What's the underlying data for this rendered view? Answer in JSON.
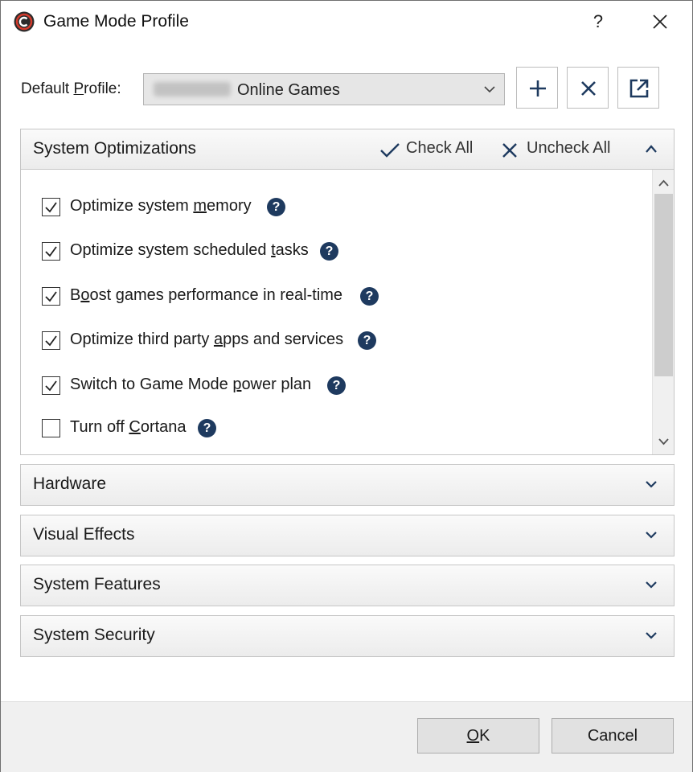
{
  "window": {
    "title": "Game Mode Profile",
    "help_label": "?"
  },
  "profile": {
    "label_before": "Default ",
    "label_accel": "P",
    "label_after": "rofile:",
    "selected_value": "Online Games"
  },
  "system_optimizations": {
    "title": "System Optimizations",
    "check_all_label": "Check All",
    "uncheck_all_label": "Uncheck All",
    "items": [
      {
        "before": "Optimize system ",
        "accel": "m",
        "after": "emory",
        "checked": true
      },
      {
        "before": "Optimize system scheduled ",
        "accel": "t",
        "after": "asks",
        "checked": true
      },
      {
        "before": "B",
        "accel": "o",
        "after": "ost games performance in real-time",
        "checked": true
      },
      {
        "before": "Optimize third party ",
        "accel": "a",
        "after": "pps and services",
        "checked": true
      },
      {
        "before": "Switch to Game Mode ",
        "accel": "p",
        "after": "ower plan",
        "checked": true
      },
      {
        "before": "Turn off ",
        "accel": "C",
        "after": "ortana",
        "checked": false
      }
    ]
  },
  "collapsed_sections": [
    {
      "title": "Hardware"
    },
    {
      "title": "Visual Effects"
    },
    {
      "title": "System Features"
    },
    {
      "title": "System Security"
    }
  ],
  "footer": {
    "ok_accel": "O",
    "ok_rest": "K",
    "cancel_label": "Cancel"
  },
  "colors": {
    "help_icon_bg": "#1e3a5f",
    "app_icon_red": "#c0392b"
  }
}
